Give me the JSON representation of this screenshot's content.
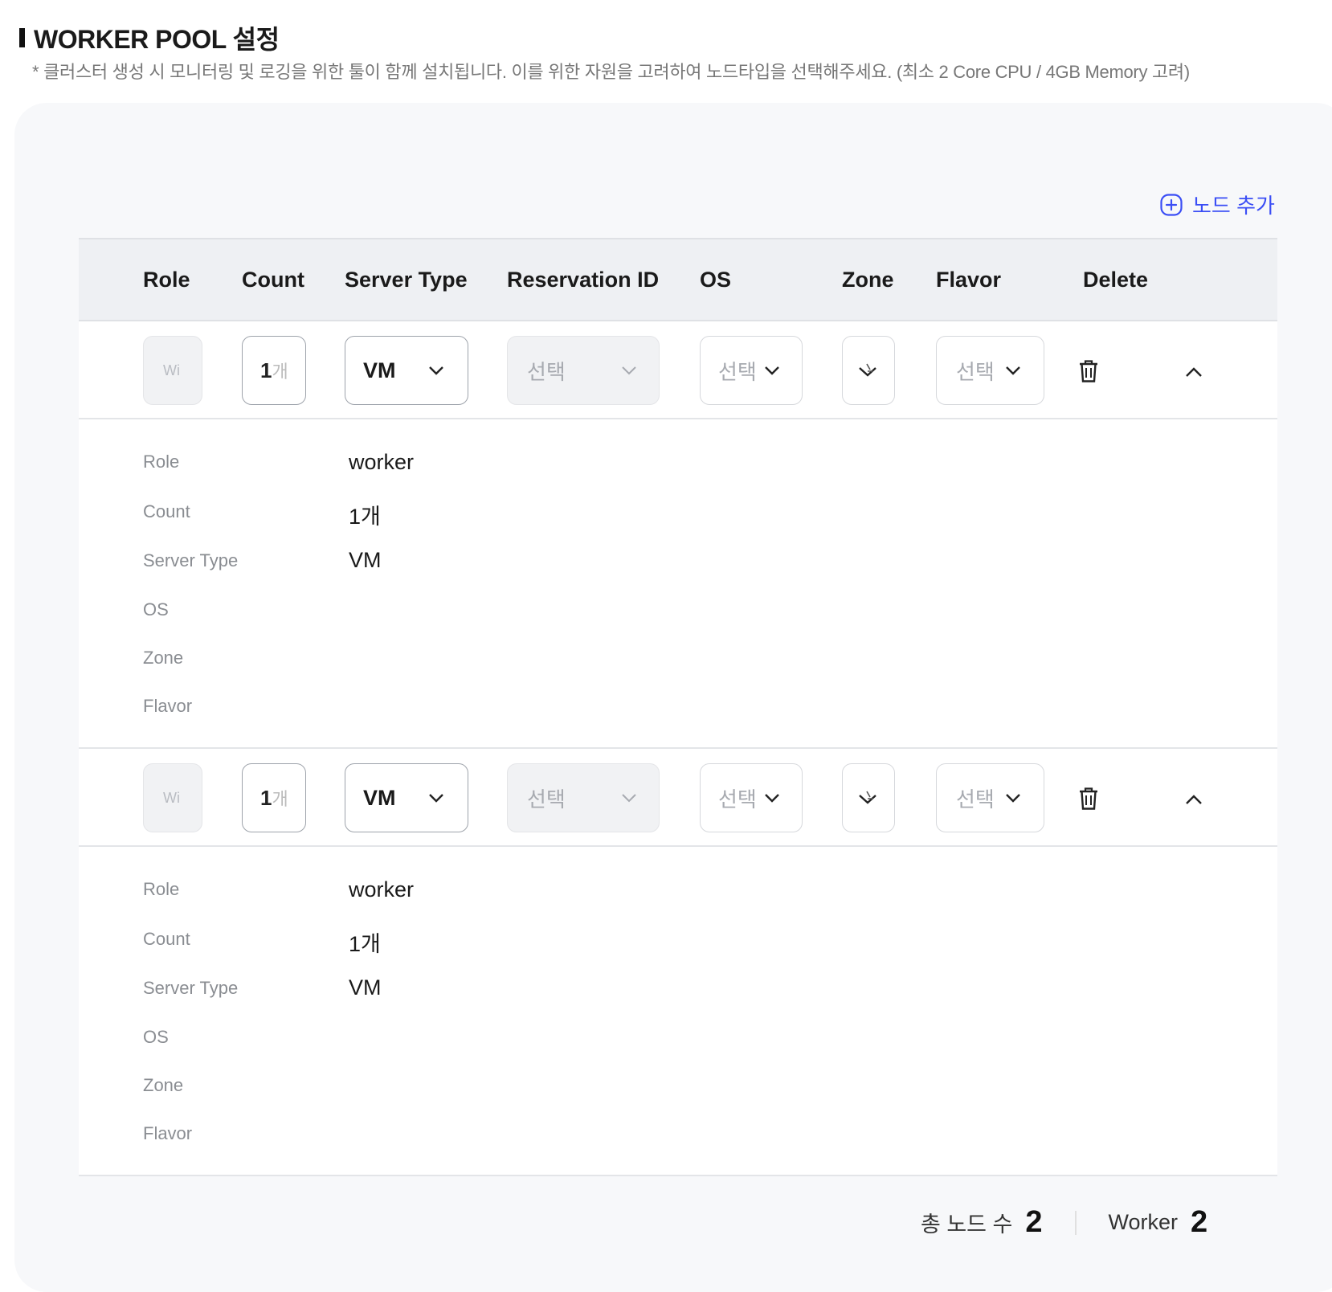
{
  "section": {
    "title": "WORKER POOL 설정",
    "note": "* 클러스터 생성 시 모니터링 및 로깅을 위한 툴이 함께 설치됩니다. 이를 위한 자원을 고려하여 노드타입을 선택해주세요. (최소 2 Core CPU / 4GB Memory 고려)"
  },
  "add_node_label": "노드 추가",
  "columns": [
    "Role",
    "Count",
    "Server Type",
    "Reservation ID",
    "OS",
    "Zone",
    "Flavor",
    "Delete"
  ],
  "rows": [
    {
      "role_input": "Wi",
      "count_value": "1",
      "count_unit": "개",
      "server_type": "VM",
      "reservation_placeholder": "선택",
      "os_placeholder": "선택",
      "flavor_placeholder": "선택",
      "details": [
        {
          "label": "Role",
          "value": "worker"
        },
        {
          "label": "Count",
          "value": "1개"
        },
        {
          "label": "Server Type",
          "value": "VM"
        },
        {
          "label": "OS",
          "value": ""
        },
        {
          "label": "Zone",
          "value": ""
        },
        {
          "label": "Flavor",
          "value": ""
        }
      ]
    },
    {
      "role_input": "Wi",
      "count_value": "1",
      "count_unit": "개",
      "server_type": "VM",
      "reservation_placeholder": "선택",
      "os_placeholder": "선택",
      "flavor_placeholder": "선택",
      "details": [
        {
          "label": "Role",
          "value": "worker"
        },
        {
          "label": "Count",
          "value": "1개"
        },
        {
          "label": "Server Type",
          "value": "VM"
        },
        {
          "label": "OS",
          "value": ""
        },
        {
          "label": "Zone",
          "value": ""
        },
        {
          "label": "Flavor",
          "value": ""
        }
      ]
    }
  ],
  "summary": {
    "total_label": "총 노드 수",
    "total_value": "2",
    "worker_label": "Worker",
    "worker_value": "2"
  },
  "colors": {
    "accent": "#3b4ef5",
    "panel": "#f7f8fa",
    "header": "#eef0f3"
  }
}
